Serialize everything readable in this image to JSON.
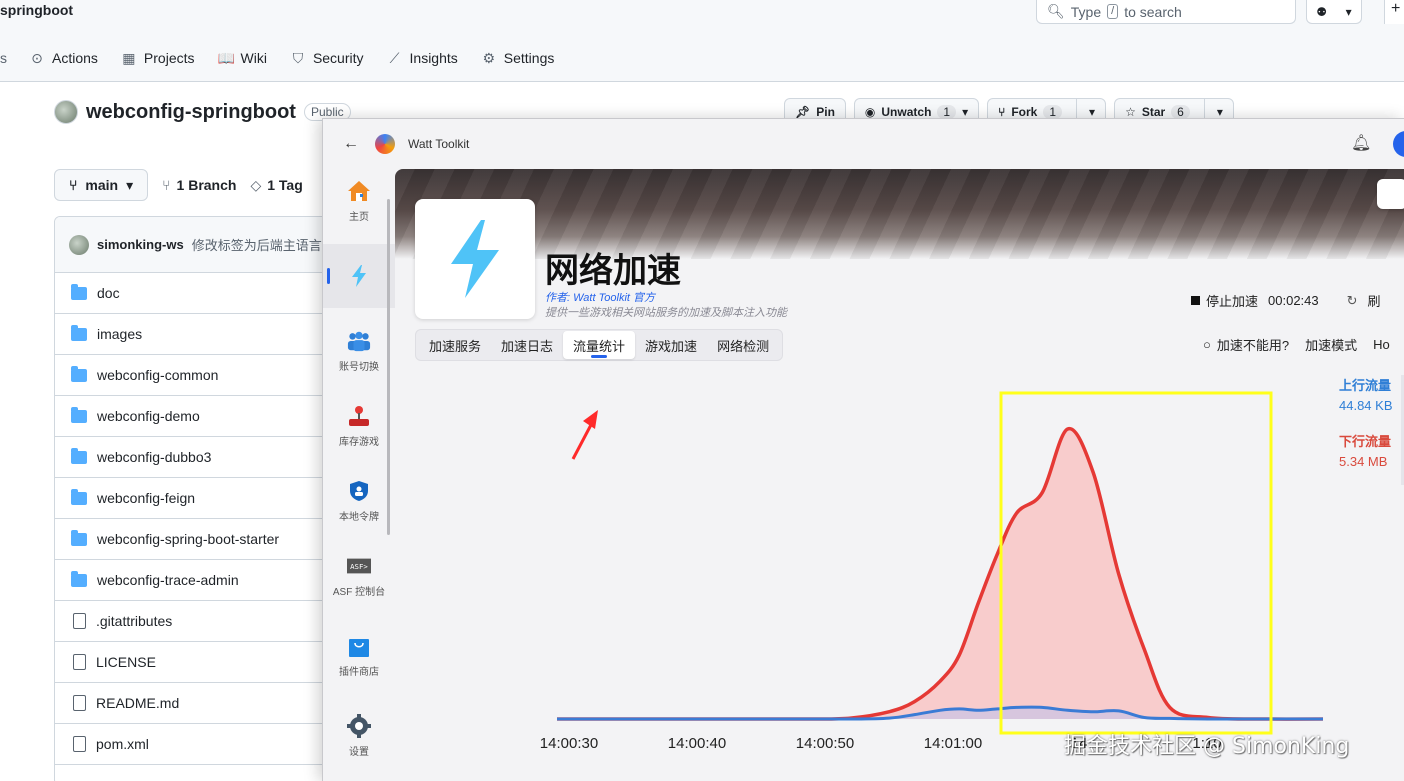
{
  "github": {
    "breadcrumb": "springboot",
    "search": {
      "pre": "Type",
      "key": "/",
      "post": "to search"
    },
    "plus": "+",
    "nav": [
      {
        "label": "Actions",
        "icon": "play-circle-icon",
        "glyph": "⊙"
      },
      {
        "label": "Projects",
        "icon": "table-icon",
        "glyph": "▦"
      },
      {
        "label": "Wiki",
        "icon": "book-icon",
        "glyph": "📖"
      },
      {
        "label": "Security",
        "icon": "shield-icon",
        "glyph": "⛉"
      },
      {
        "label": "Insights",
        "icon": "graph-icon",
        "glyph": "⟋"
      },
      {
        "label": "Settings",
        "icon": "gear-icon",
        "glyph": "⚙"
      }
    ],
    "repo": {
      "name": "webconfig-springboot",
      "visibility": "Public"
    },
    "buttons": {
      "pin": "Pin",
      "unwatch": "Unwatch",
      "unwatch_count": "1",
      "fork": "Fork",
      "fork_count": "1",
      "star": "Star",
      "star_count": "6"
    },
    "branch": {
      "name": "main",
      "branches": "1 Branch",
      "tags": "1 Tag"
    },
    "commit": {
      "author": "simonking-ws",
      "message": "修改标签为后端主语言"
    },
    "files": [
      {
        "name": "doc",
        "type": "dir"
      },
      {
        "name": "images",
        "type": "dir"
      },
      {
        "name": "webconfig-common",
        "type": "dir"
      },
      {
        "name": "webconfig-demo",
        "type": "dir"
      },
      {
        "name": "webconfig-dubbo3",
        "type": "dir"
      },
      {
        "name": "webconfig-feign",
        "type": "dir"
      },
      {
        "name": "webconfig-spring-boot-starter",
        "type": "dir"
      },
      {
        "name": "webconfig-trace-admin",
        "type": "dir"
      },
      {
        "name": ".gitattributes",
        "type": "file"
      },
      {
        "name": "LICENSE",
        "type": "file"
      },
      {
        "name": "README.md",
        "type": "file"
      },
      {
        "name": "pom.xml",
        "type": "file"
      }
    ]
  },
  "watt": {
    "app_name": "Watt Toolkit",
    "sidebar": [
      {
        "label": "主页",
        "icon": "home-icon"
      },
      {
        "label": "",
        "icon": "lightning-icon",
        "active": true
      },
      {
        "label": "账号切换",
        "icon": "accounts-icon"
      },
      {
        "label": "库存游戏",
        "icon": "joystick-icon"
      },
      {
        "label": "本地令牌",
        "icon": "shield-icon"
      },
      {
        "label": "ASF 控制台",
        "icon": "asf-icon"
      },
      {
        "label": "插件商店",
        "icon": "store-bag-icon"
      },
      {
        "label": "设置",
        "icon": "gear-icon"
      }
    ],
    "plugin": {
      "title": "网络加速",
      "author": "作者:  Watt Toolkit  官方",
      "desc": "提供一些游戏相关网站服务的加速及脚本注入功能"
    },
    "stop": {
      "label": "停止加速",
      "time": "00:02:43",
      "refresh": "刷"
    },
    "tabs": [
      "加速服务",
      "加速日志",
      "流量统计",
      "游戏加速",
      "网络检测"
    ],
    "active_tab": 2,
    "accel_help": "加速不能用?",
    "accel_mode": "加速模式",
    "accel_mode_value": "Ho",
    "legend": {
      "up_label": "上行流量",
      "up_value": "44.84 KB",
      "down_label": "下行流量",
      "down_value": "5.34 MB"
    },
    "colors": {
      "up": "#3a7bd5",
      "down": "#e53935",
      "down_fill": "#f8cccc",
      "highlight": "#ffff1a",
      "arrow": "#ff2a2a"
    }
  },
  "chart_data": {
    "type": "area",
    "x_ticks": [
      "14:00:30",
      "14:00:40",
      "14:00:50",
      "14:01:00",
      "14",
      "1:10"
    ],
    "x": [
      0,
      3.5,
      7,
      10,
      14,
      17,
      20,
      23,
      26,
      28,
      30,
      31.5,
      33,
      34.5,
      36,
      38,
      40,
      42,
      44,
      46,
      48,
      51,
      55,
      60
    ],
    "series": [
      {
        "name": "下行流量",
        "values": [
          0,
          0,
          0,
          0,
          0,
          0,
          0,
          0.3,
          2.5,
          6,
          13,
          22,
          40,
          57,
          71,
          78,
          100,
          85,
          50,
          24,
          4,
          0.5,
          0,
          0
        ]
      },
      {
        "name": "上行流量",
        "values": [
          0,
          0,
          0,
          0,
          0,
          0,
          0,
          0,
          0.3,
          1.5,
          3,
          3.5,
          3,
          3.5,
          4,
          4,
          3,
          2.5,
          2.8,
          0.5,
          0.2,
          0,
          0,
          0
        ]
      }
    ],
    "xlim": [
      0,
      60
    ],
    "ylim": [
      0,
      100
    ],
    "grid": false
  }
}
